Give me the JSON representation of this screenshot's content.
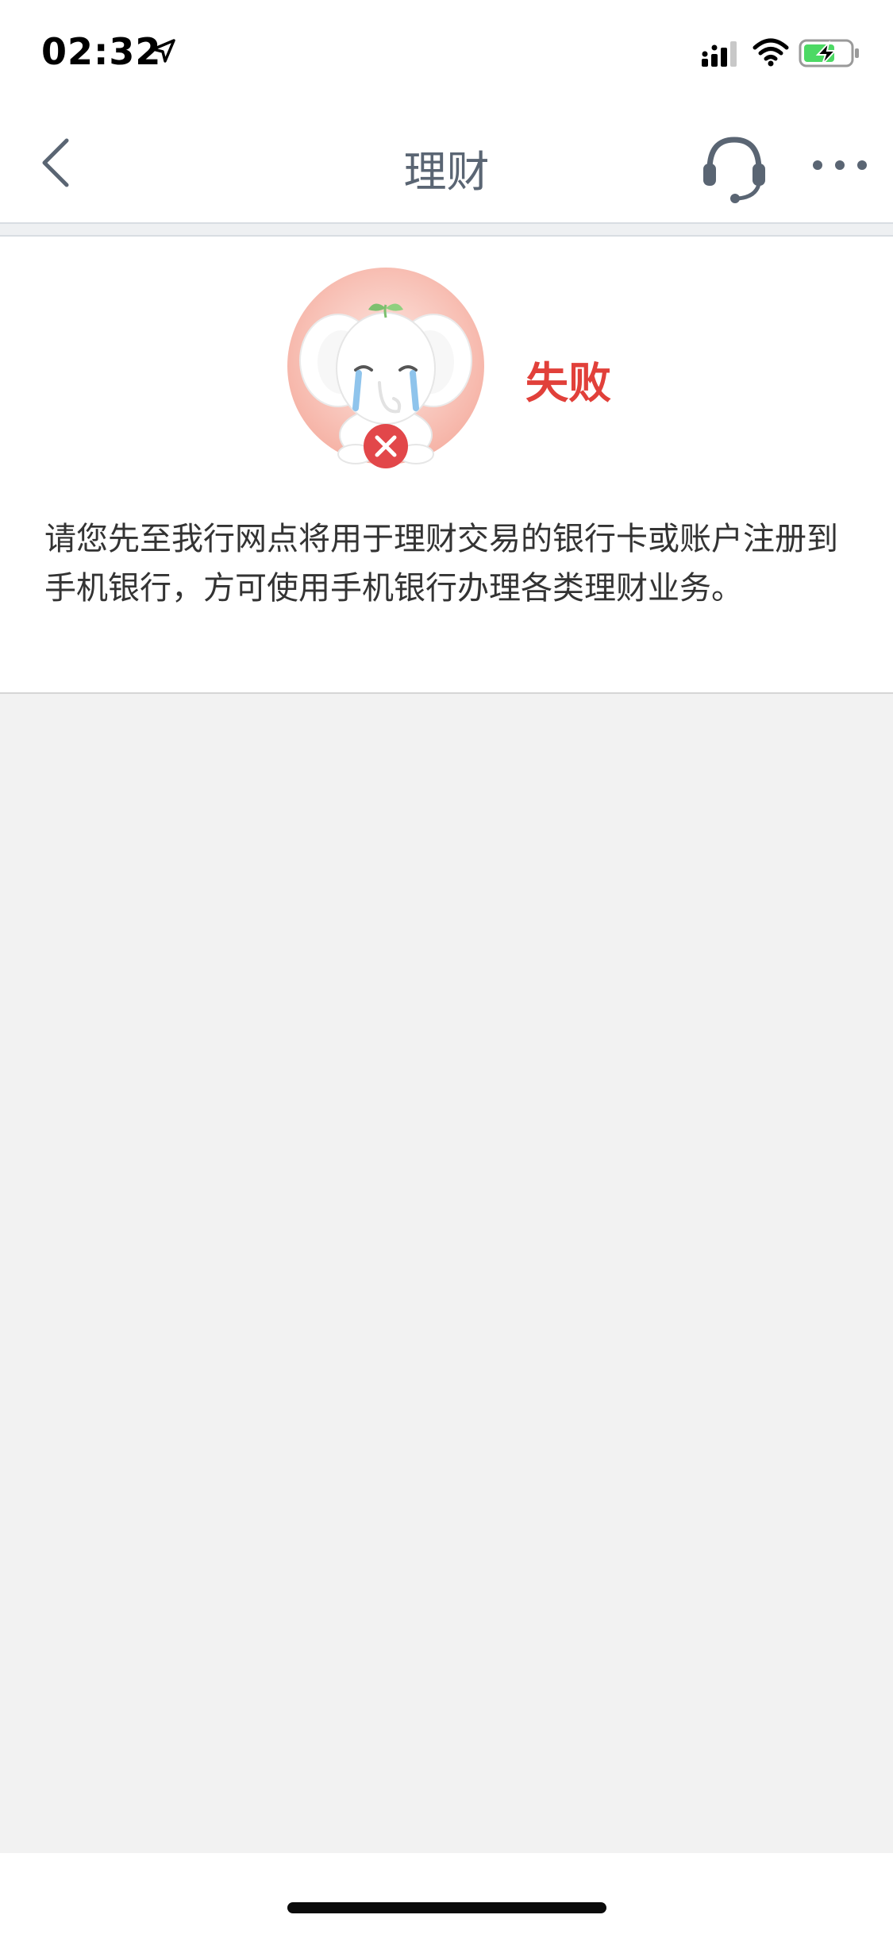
{
  "status_bar": {
    "time": "02:32",
    "icons": [
      "location-arrow-icon",
      "cellular-signal-icon",
      "wifi-icon",
      "battery-charging-icon"
    ]
  },
  "nav": {
    "title": "理财",
    "back_icon": "chevron-left-icon",
    "service_icon": "headset-icon",
    "more_icon": "more-dots-icon"
  },
  "result": {
    "status": "失败",
    "status_color": "#e1403a",
    "mascot_icon": "crying-elephant-icon",
    "message": "请您先至我行网点将用于理财交易的银行卡或账户注册到手机银行，方可使用手机银行办理各类理财业务。"
  },
  "colors": {
    "nav_title": "#5a6573",
    "page_background": "#f2f2f2",
    "card_background": "#ffffff",
    "error_red": "#e1403a"
  }
}
